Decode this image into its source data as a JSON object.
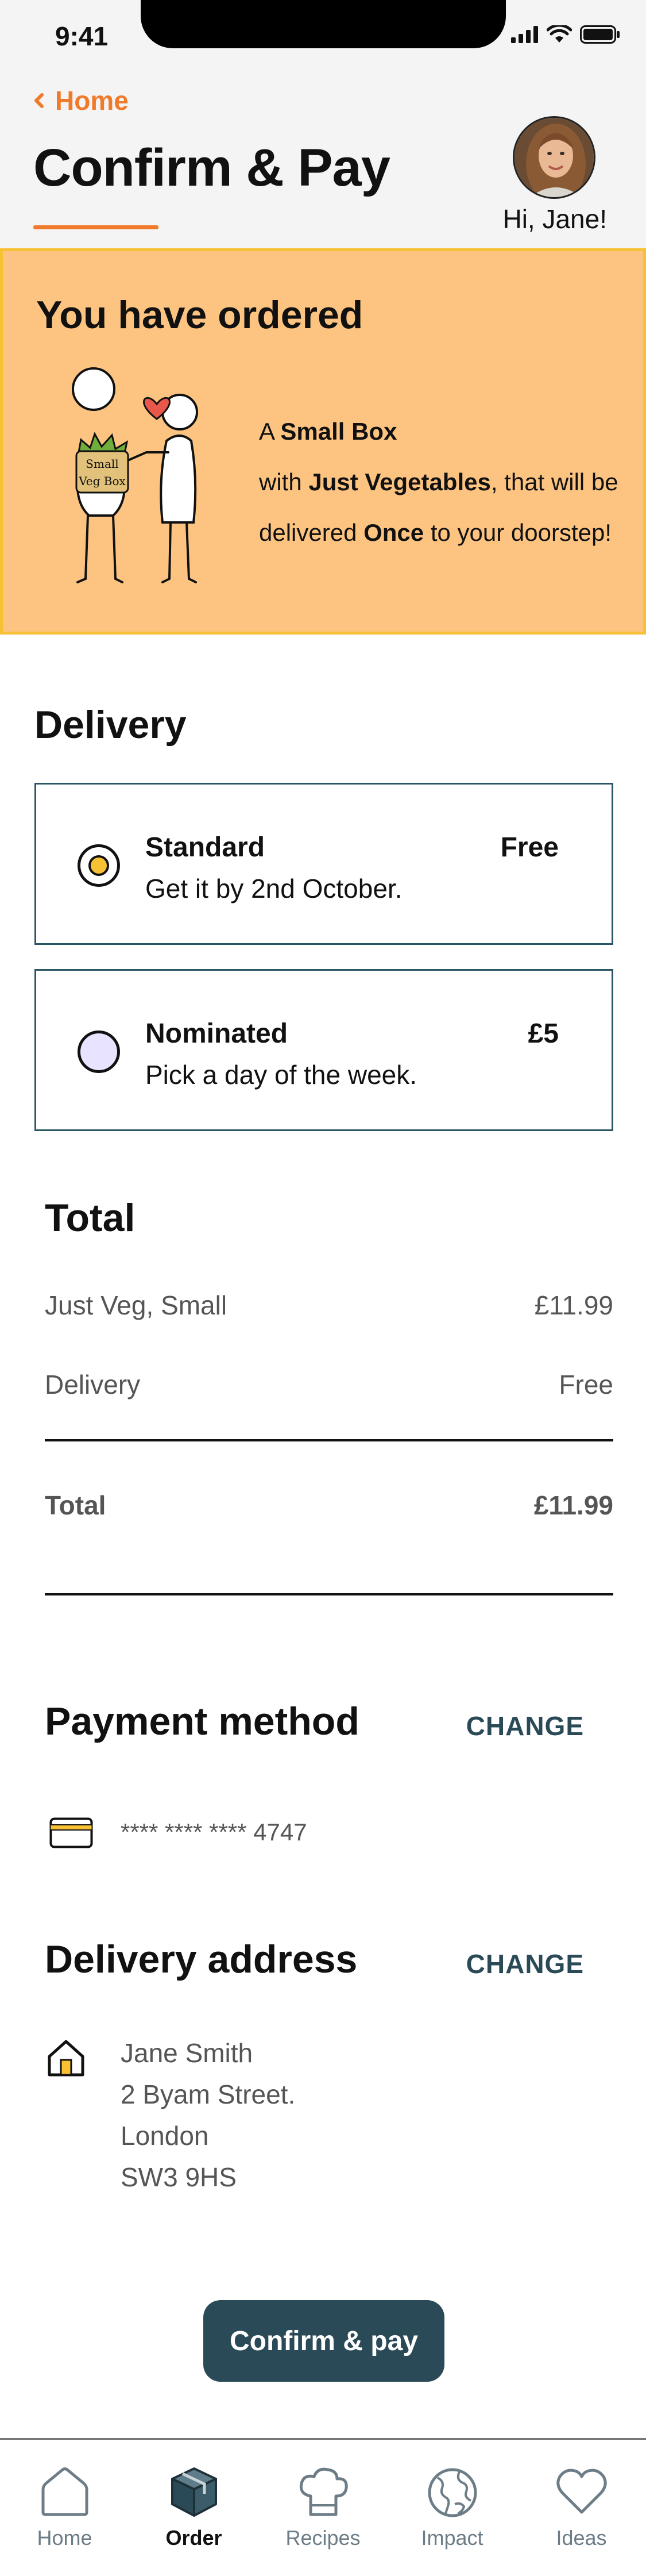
{
  "status": {
    "time": "9:41"
  },
  "header": {
    "back_label": "Home",
    "title": "Confirm & Pay",
    "greeting": "Hi, Jane!"
  },
  "order": {
    "title": "You have ordered",
    "line1_pre": "A ",
    "box": "Small Box",
    "line2_pre": "with ",
    "contents": "Just Vegetables",
    "line2_post": ", that will be",
    "line3_pre": "delivered ",
    "frequency": "Once",
    "line3_post": " to your doorstep!",
    "bag_label_1": "Small",
    "bag_label_2": "Veg Box"
  },
  "delivery": {
    "title": "Delivery",
    "options": [
      {
        "name": "Standard",
        "desc": "Get it by 2nd October.",
        "price": "Free",
        "selected": true
      },
      {
        "name": "Nominated",
        "desc": "Pick a day of the week.",
        "price": "£5",
        "selected": false
      }
    ]
  },
  "total": {
    "title": "Total",
    "items": [
      {
        "label": "Just Veg, Small",
        "value": "£11.99"
      },
      {
        "label": "Delivery",
        "value": "Free"
      }
    ],
    "total_label": "Total",
    "total_value": "£11.99"
  },
  "payment": {
    "title": "Payment method",
    "change_label": "CHANGE",
    "card": "**** **** **** 4747"
  },
  "address": {
    "title": "Delivery address",
    "change_label": "CHANGE",
    "lines": [
      "Jane Smith",
      "2 Byam Street.",
      "London",
      "SW3 9HS"
    ]
  },
  "cta": {
    "label": "Confirm & pay"
  },
  "tabs": [
    {
      "label": "Home",
      "icon": "home-icon",
      "active": false
    },
    {
      "label": "Order",
      "icon": "box-icon",
      "active": true
    },
    {
      "label": "Recipes",
      "icon": "chef-hat-icon",
      "active": false
    },
    {
      "label": "Impact",
      "icon": "globe-icon",
      "active": false
    },
    {
      "label": "Ideas",
      "icon": "heart-icon",
      "active": false
    }
  ],
  "colors": {
    "accent": "#f07a2a",
    "order_bg": "#fdc481",
    "order_border": "#f8c133",
    "primary_dark": "#2a4a57"
  }
}
